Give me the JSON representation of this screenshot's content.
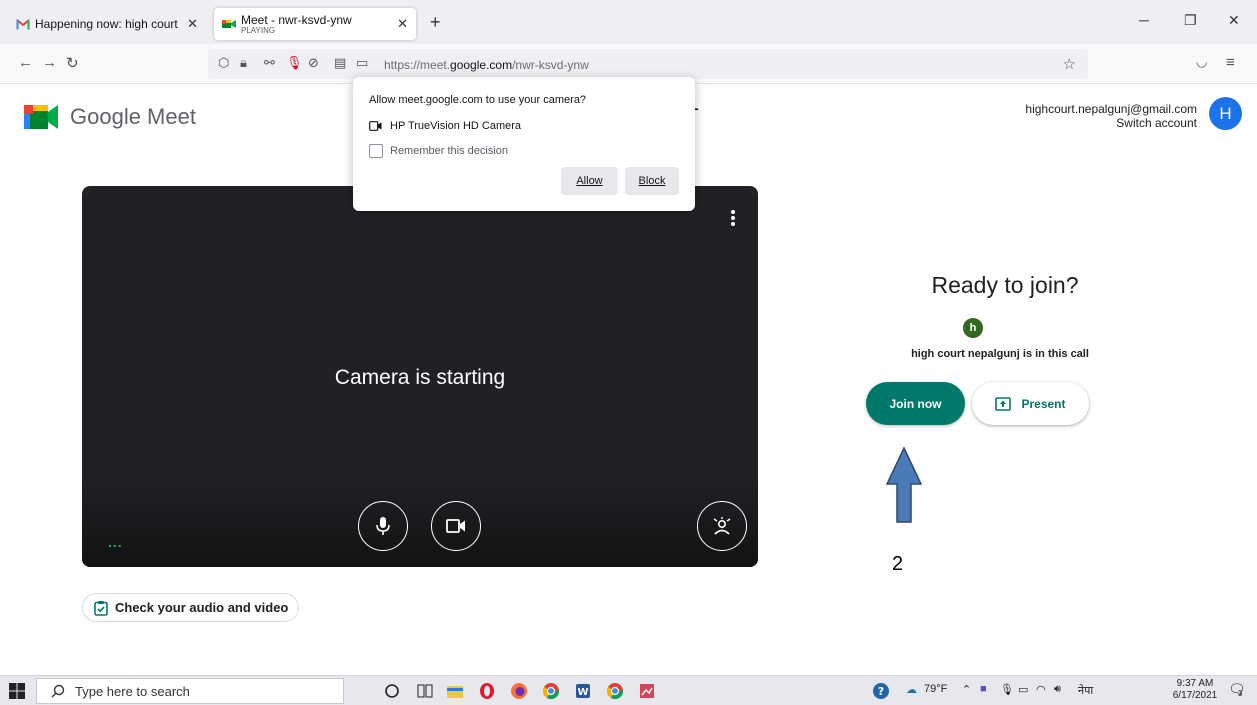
{
  "browser": {
    "tabs": [
      {
        "label": "Happening now: high court nep",
        "active": false
      },
      {
        "label": "Meet - nwr-ksvd-ynw",
        "sublabel": "PLAYING",
        "active": true
      }
    ],
    "url_prefix": "https://meet.",
    "url_domain": "google.com",
    "url_path": "/nwr-ksvd-ynw"
  },
  "header": {
    "app_name": "Google Meet",
    "account_email": "highcourt.nepalgunj@gmail.com",
    "switch_account": "Switch account",
    "avatar_letter": "H"
  },
  "permission_popup": {
    "question": "Allow meet.google.com to use your camera?",
    "camera_name": "HP TrueVision HD Camera",
    "remember_label": "Remember this decision",
    "allow_label": "Allow",
    "block_label": "Block"
  },
  "annotations": {
    "step1": "1",
    "step2": "2",
    "arrow_color": "#2f4a6e"
  },
  "video": {
    "status": "Camera is starting",
    "dots": "..."
  },
  "check_button": "Check your audio and video",
  "join_panel": {
    "title": "Ready to join?",
    "participant_initial": "h",
    "in_call_text": "high court nepalgunj is in this call",
    "join_label": "Join now",
    "present_label": "Present"
  },
  "taskbar": {
    "search_placeholder": "Type here to search",
    "weather": "79°F",
    "lang": "नेपा",
    "time": "9:37 AM",
    "date": "6/17/2021",
    "notifications": "3"
  },
  "colors": {
    "meet_green": "#00796b",
    "account_blue": "#1a73e8",
    "video_bg": "#202124"
  }
}
